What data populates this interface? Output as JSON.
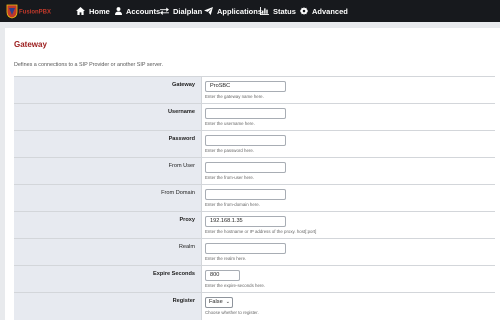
{
  "nav": {
    "logo_text": "FusionPBX",
    "items": [
      {
        "label": "Home",
        "icon": "home-icon"
      },
      {
        "label": "Accounts",
        "icon": "user-icon"
      },
      {
        "label": "Dialplan",
        "icon": "exchange-arrows-icon"
      },
      {
        "label": "Applications",
        "icon": "paper-plane-icon"
      },
      {
        "label": "Status",
        "icon": "bar-chart-icon"
      },
      {
        "label": "Advanced",
        "icon": "gear-icon"
      }
    ]
  },
  "page": {
    "title": "Gateway",
    "description": "Defines a connections to a SIP Provider or another SIP server."
  },
  "form": {
    "gateway": {
      "label": "Gateway",
      "value": "ProSBC",
      "placeholder": "",
      "hint": "Enter the gateway name here."
    },
    "username": {
      "label": "Username",
      "value": "",
      "hint": "Enter the username here."
    },
    "password": {
      "label": "Password",
      "value": "",
      "hint": "Enter the password here."
    },
    "from_user": {
      "label": "From User",
      "value": "",
      "hint": "Enter the from-user here."
    },
    "from_domain": {
      "label": "From Domain",
      "value": "",
      "hint": "Enter the from-domain here."
    },
    "proxy": {
      "label": "Proxy",
      "value": "192.168.1.35",
      "hint": "Enter the hostname or IP address of the proxy. host[:port]"
    },
    "realm": {
      "label": "Realm",
      "value": "",
      "hint": "Enter the realm here."
    },
    "expire_seconds": {
      "label": "Expire Seconds",
      "value": "800",
      "hint": "Enter the expire-seconds here."
    },
    "register": {
      "label": "Register",
      "value": "False",
      "hint": "Choose whether to register."
    }
  }
}
